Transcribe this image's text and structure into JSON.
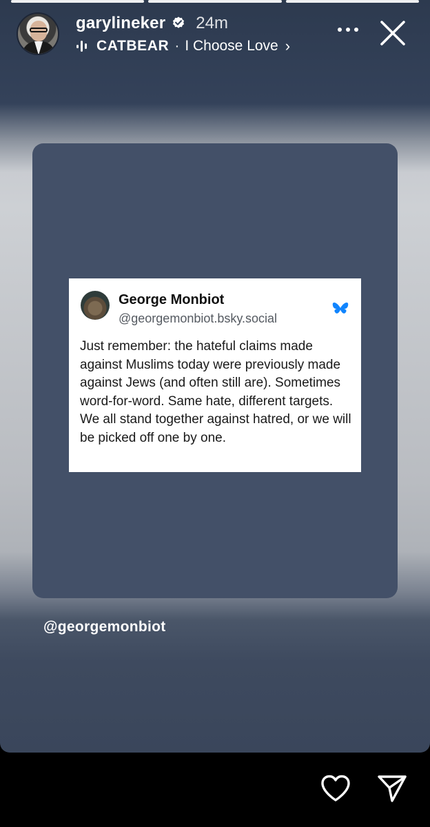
{
  "story": {
    "progress": {
      "segments": 3,
      "current_index": 2
    },
    "user": {
      "username": "garylineker",
      "verified": true,
      "time_ago": "24m",
      "avatar": "profile-photo"
    },
    "music": {
      "icon": "audio-bars-icon",
      "artist": "CATBEAR",
      "separator": "·",
      "title": "I Choose Love",
      "chevron": "›"
    },
    "actions": {
      "more_icon": "ellipsis-icon",
      "close_icon": "close-icon"
    },
    "shared_post": {
      "author_name": "George Monbiot",
      "author_handle": "@georgemonbiot.bsky.social",
      "platform_icon": "butterfly-icon",
      "text": "Just remember: the hateful claims made against Muslims today were previously made against Jews (and often still are). Sometimes word-for-word. Same hate, different targets. We all stand together against hatred, or we will be picked off one by one."
    },
    "mention": "@georgemonbiot",
    "footer": {
      "like_icon": "heart-icon",
      "share_icon": "send-icon"
    }
  },
  "colors": {
    "card": "#435068",
    "background_top": "#2d3a4f",
    "butterfly": "#1185fe",
    "text_white": "#ffffff"
  }
}
